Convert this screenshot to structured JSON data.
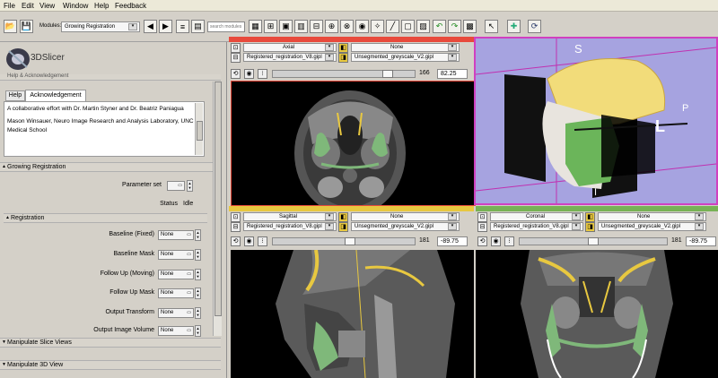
{
  "menu": [
    "File",
    "Edit",
    "View",
    "Window",
    "Help",
    "Feedback"
  ],
  "toolbar": {
    "modules_label": "Modules:",
    "module_selected": "Growing Registration",
    "search_placeholder": "search modules",
    "colors": {
      "undo_green": "#1f8a1f",
      "accent_red": "#e84a3c",
      "accent_yellow": "#e8c840",
      "accent_green": "#77b255"
    }
  },
  "app": {
    "logo_text": "3DSlicer"
  },
  "help_panel": {
    "title": "Help & Acknowledgement",
    "tabs": [
      "Help",
      "Acknowledgement"
    ],
    "text_1": "A collaborative effort with Dr. Martin Styner and Dr. Beatriz Paniagua",
    "text_2": "Mason Winsauer, Neuro Image Research and Analysis Laboratory, UNC Medical School"
  },
  "growing_registration": {
    "title": "Growing Registration",
    "parameter_set_label": "Parameter set",
    "status_label": "Status",
    "status_value": "Idle"
  },
  "registration": {
    "title": "Registration",
    "fields": [
      {
        "label": "Baseline (Fixed)",
        "value": "None"
      },
      {
        "label": "Baseline Mask",
        "value": "None"
      },
      {
        "label": "Follow Up (Moving)",
        "value": "None"
      },
      {
        "label": "Follow Up Mask",
        "value": "None"
      },
      {
        "label": "Output Transform",
        "value": "None"
      },
      {
        "label": "Output Image Volume",
        "value": "None"
      }
    ]
  },
  "collapsed_sections": [
    "Manipulate Slice Views",
    "Manipulate 3D View"
  ],
  "views": {
    "axial": {
      "orientation": "Axial",
      "fg": "None",
      "bg_volume": "Registered_registration_V8.gipl",
      "label_volume": "Unsegmented_greyscale_V2.gipl",
      "value": "166",
      "offset": "82.25",
      "color": "#e84a3c"
    },
    "sagittal": {
      "orientation": "Sagittal",
      "fg": "None",
      "bg_volume": "Registered_registration_V8.gipl",
      "label_volume": "Unsegmented_greyscale_V2.gipl",
      "value": "181",
      "offset": "-89.75",
      "color": "#e8c840"
    },
    "coronal": {
      "orientation": "Coronal",
      "fg": "None",
      "bg_volume": "Registered_registration_V8.gipl",
      "label_volume": "Unsegmented_greyscale_V2.gipl",
      "value": "181",
      "offset": "-89.75",
      "color": "#77b255"
    },
    "three_d": {
      "labels": {
        "superior": "S",
        "posterior": "P",
        "left": "L",
        "inferior": "I"
      },
      "background": "#a6a3e0"
    }
  }
}
